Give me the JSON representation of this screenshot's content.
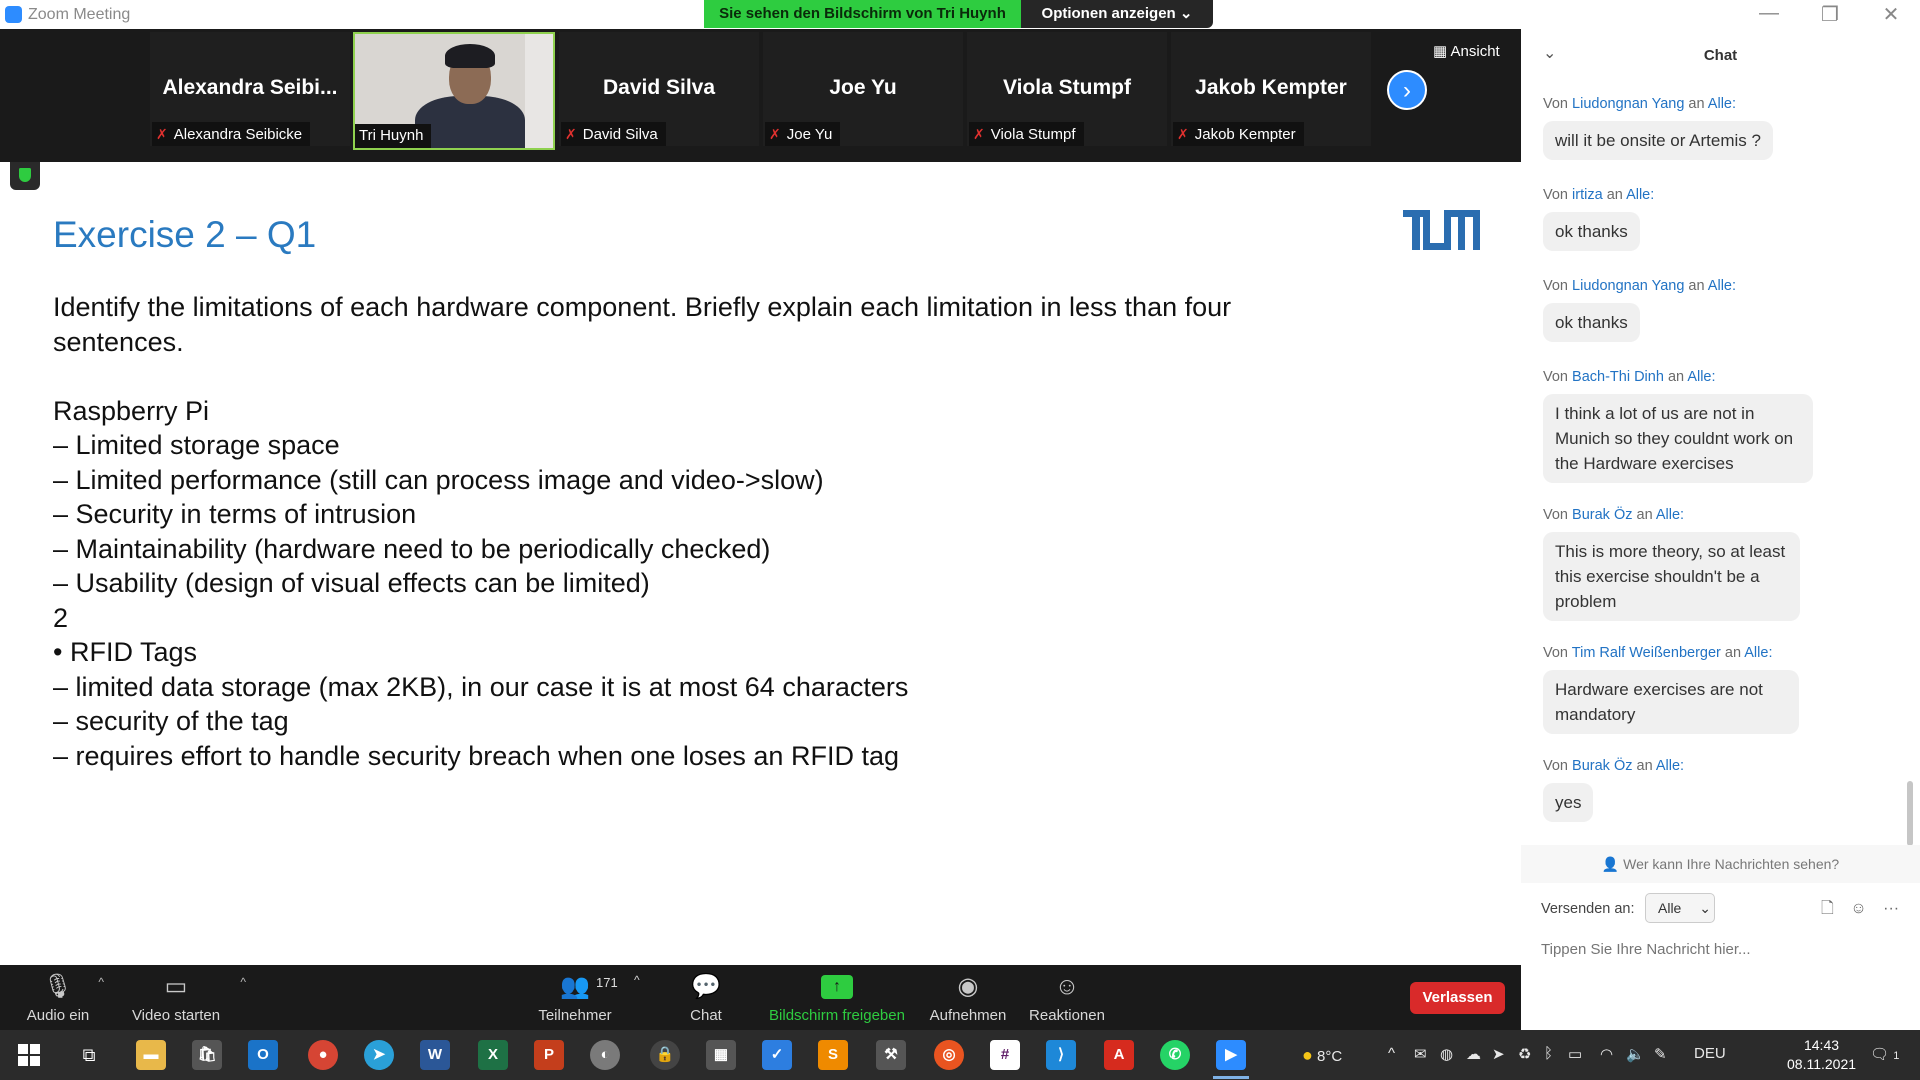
{
  "window": {
    "title": "Zoom Meeting",
    "share_banner": "Sie sehen den Bildschirm von Tri Huynh",
    "options_label": "Optionen anzeigen",
    "minimize": "—",
    "restore": "❐",
    "close": "✕"
  },
  "participants": [
    {
      "display_name": "Alexandra  Seibi...",
      "label": "Alexandra Seibicke",
      "muted": true,
      "video": false
    },
    {
      "display_name": "",
      "label": "Tri Huynh",
      "muted": false,
      "video": true
    },
    {
      "display_name": "David Silva",
      "label": "David Silva",
      "muted": true,
      "video": false
    },
    {
      "display_name": "Joe Yu",
      "label": "Joe Yu",
      "muted": true,
      "video": false
    },
    {
      "display_name": "Viola Stumpf",
      "label": "Viola Stumpf",
      "muted": true,
      "video": false
    },
    {
      "display_name": "Jakob Kempter",
      "label": "Jakob Kempter",
      "muted": true,
      "video": false
    }
  ],
  "view_label": "Ansicht",
  "slide": {
    "title": "Exercise 2 – Q1",
    "logo_text": "TUM",
    "lines": [
      "Identify the limitations of each hardware component. Briefly explain each limitation in less than four",
      "sentences.",
      "",
      "Raspberry Pi",
      "– Limited storage space",
      "– Limited performance (still can process image and video->slow)",
      "– Security in terms of intrusion",
      "– Maintainability (hardware need to be periodically checked)",
      "– Usability (design of visual effects can be limited)",
      "2",
      "• RFID Tags",
      "– limited data storage (max 2KB), in our case it is at most 64 characters",
      "– security of the tag",
      "– requires effort to handle security breach when one loses an RFID tag"
    ]
  },
  "toolbar": {
    "audio": "Audio ein",
    "video": "Video starten",
    "participants": "Teilnehmer",
    "participant_count": "171",
    "chat": "Chat",
    "share": "Bildschirm freigeben",
    "record": "Aufnehmen",
    "reactions": "Reaktionen",
    "leave": "Verlassen"
  },
  "chat": {
    "title": "Chat",
    "from_prefix": "Von",
    "to_word": "an",
    "to_all": "Alle:",
    "messages": [
      {
        "sender": "Liudongnan Yang",
        "text": "will it be onsite or Artemis ?"
      },
      {
        "sender": "irtiza",
        "text": "ok thanks"
      },
      {
        "sender": "Liudongnan Yang",
        "text": "ok thanks"
      },
      {
        "sender": "Bach-Thi Dinh",
        "text": "I think a lot of us are not in Munich so they couldnt work on the Hardware exercises"
      },
      {
        "sender": "Burak Öz",
        "text": "This is more theory, so at least this exercise shouldn't be a problem"
      },
      {
        "sender": "Tim Ralf Weißenberger",
        "text": "Hardware exercises are not mandatory"
      },
      {
        "sender": "Burak Öz",
        "text": "yes"
      }
    ],
    "who_can_see": "Wer kann Ihre Nachrichten sehen?",
    "send_to_label": "Versenden an:",
    "send_to_value": "Alle",
    "input_placeholder": "Tippen Sie Ihre Nachricht hier..."
  },
  "taskbar": {
    "weather": "8°C",
    "language": "DEU",
    "time": "14:43",
    "date": "08.11.2021",
    "notification_count": "1",
    "apps": [
      "file-explorer",
      "store",
      "outlook",
      "chrome",
      "telegram",
      "word",
      "excel",
      "powerpoint",
      "paint",
      "keepass",
      "calculator",
      "ticktick",
      "sublime",
      "tools",
      "ubuntu",
      "slack",
      "vscode",
      "acrobat",
      "whatsapp",
      "zoom"
    ]
  },
  "colors": {
    "zoom_blue": "#2d8cff",
    "share_green": "#2ecc40",
    "leave_red": "#d92a2a",
    "slide_title": "#2a7ac0",
    "chat_sender": "#2273c4"
  }
}
